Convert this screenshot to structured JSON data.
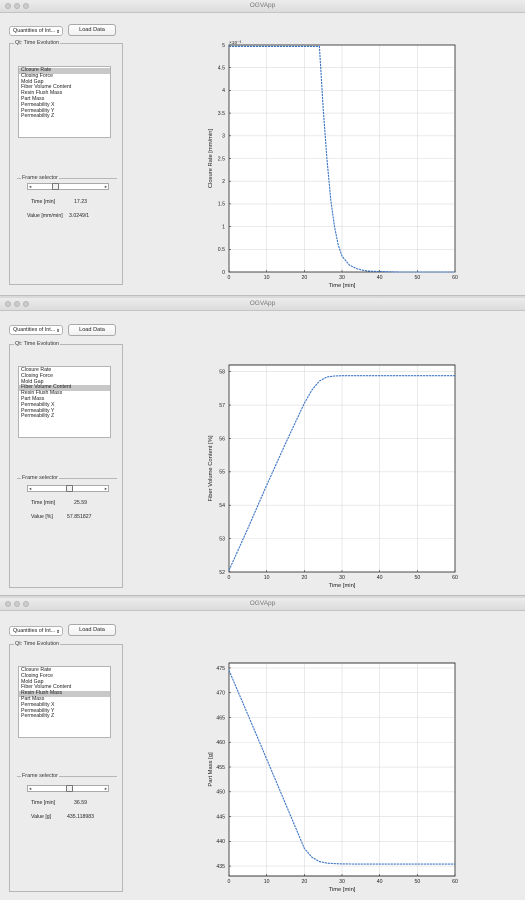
{
  "windows": [
    {
      "title": "OGVApp",
      "dropdown": "Quantities of Int...",
      "load_button": "Load Data",
      "panel_title": "Qt: Time Evolution",
      "quantities": [
        "Closure Rate",
        "Closing Force",
        "Mold Gap",
        "Fiber Volume Content",
        "Resin Flush Mass",
        "Part Mass",
        "Permeability X",
        "Permeability Y",
        "Permeability Z"
      ],
      "selected_index": 0,
      "frame_selector_title": "Frame selector",
      "slider_fraction": 0.29,
      "time_label": "Time [min]",
      "time_value": "17.23",
      "value_label": "Value [mm/min]",
      "value_value": "3.0249/1"
    },
    {
      "title": "OGVApp",
      "dropdown": "Quantities of Int...",
      "load_button": "Load Data",
      "panel_title": "Qt: Time Evolution",
      "quantities": [
        "Closure Rate",
        "Closing Force",
        "Mold Gap",
        "Fiber Volume Content",
        "Resin Flush Mass",
        "Part Mass",
        "Permeability X",
        "Permeability Y",
        "Permeability Z"
      ],
      "selected_index": 3,
      "frame_selector_title": "Frame selector",
      "slider_fraction": 0.47,
      "time_label": "Time [min]",
      "time_value": "25.59",
      "value_label": "Value [%]",
      "value_value": "57.851827"
    },
    {
      "title": "OGVApp",
      "dropdown": "Quantities of Int...",
      "load_button": "Load Data",
      "panel_title": "Qt: Time Evolution",
      "quantities": [
        "Closure Rate",
        "Closing Force",
        "Mold Gap",
        "Fiber Volume Content",
        "Resin Flush Mass",
        "Part Mass",
        "Permeability X",
        "Permeability Y",
        "Permeability Z"
      ],
      "selected_index": 4,
      "frame_selector_title": "Frame selector",
      "slider_fraction": 0.47,
      "time_label": "Time [min]",
      "time_value": "36.59",
      "value_label": "Value [g]",
      "value_value": "435.118983"
    }
  ],
  "chart_data": [
    {
      "type": "line",
      "title": "",
      "xlabel": "Time [min]",
      "ylabel": "Closure Rate [mm/min]",
      "exponent_label": "×10⁻³",
      "xlim": [
        0,
        60
      ],
      "ylim": [
        0,
        5
      ],
      "xticks": [
        0,
        10,
        20,
        30,
        40,
        50,
        60
      ],
      "yticks": [
        0,
        0.5,
        1,
        1.5,
        2,
        2.5,
        3,
        3.5,
        4,
        4.5,
        5
      ],
      "ytick_labels": [
        "0",
        "0.5",
        "1",
        "1.5",
        "2",
        "2.5",
        "3",
        "3.5",
        "4",
        "4.5",
        "5"
      ],
      "grid": true,
      "color": "#3b74c4",
      "x": [
        0,
        24,
        25,
        26,
        27,
        28,
        29,
        30,
        32,
        34,
        36,
        38,
        40,
        45,
        50,
        55,
        60
      ],
      "y": [
        4.97,
        4.97,
        3.6,
        2.5,
        1.6,
        1.0,
        0.6,
        0.35,
        0.15,
        0.07,
        0.03,
        0.015,
        0.01,
        0.0,
        0.0,
        0.0,
        0.0
      ]
    },
    {
      "type": "line",
      "title": "",
      "xlabel": "Time [min]",
      "ylabel": "Fiber Volume Content [%]",
      "xlim": [
        0,
        60
      ],
      "ylim": [
        52,
        58.2
      ],
      "xticks": [
        0,
        10,
        20,
        30,
        40,
        50,
        60
      ],
      "yticks": [
        52,
        53,
        54,
        55,
        56,
        57,
        58
      ],
      "ytick_labels": [
        "52",
        "53",
        "54",
        "55",
        "56",
        "57",
        "58"
      ],
      "grid": true,
      "color": "#3b74c4",
      "x": [
        0,
        5,
        10,
        15,
        20,
        22,
        24,
        26,
        28,
        30,
        35,
        40,
        50,
        60
      ],
      "y": [
        52.05,
        53.3,
        54.6,
        55.85,
        57.05,
        57.45,
        57.72,
        57.84,
        57.87,
        57.88,
        57.88,
        57.88,
        57.88,
        57.88
      ]
    },
    {
      "type": "line",
      "title": "",
      "xlabel": "Time [min]",
      "ylabel": "Part Mass [g]",
      "xlim": [
        0,
        60
      ],
      "ylim": [
        433,
        476
      ],
      "xticks": [
        0,
        10,
        20,
        30,
        40,
        50,
        60
      ],
      "yticks": [
        435,
        440,
        445,
        450,
        455,
        460,
        465,
        470,
        475
      ],
      "ytick_labels": [
        "435",
        "440",
        "445",
        "450",
        "455",
        "460",
        "465",
        "470",
        "475"
      ],
      "grid": true,
      "color": "#3b74c4",
      "x": [
        0,
        5,
        10,
        15,
        20,
        22,
        24,
        26,
        28,
        30,
        35,
        40,
        50,
        60
      ],
      "y": [
        474.5,
        465.6,
        456.6,
        447.6,
        438.6,
        436.8,
        435.9,
        435.6,
        435.5,
        435.45,
        435.4,
        435.4,
        435.4,
        435.4
      ]
    }
  ]
}
